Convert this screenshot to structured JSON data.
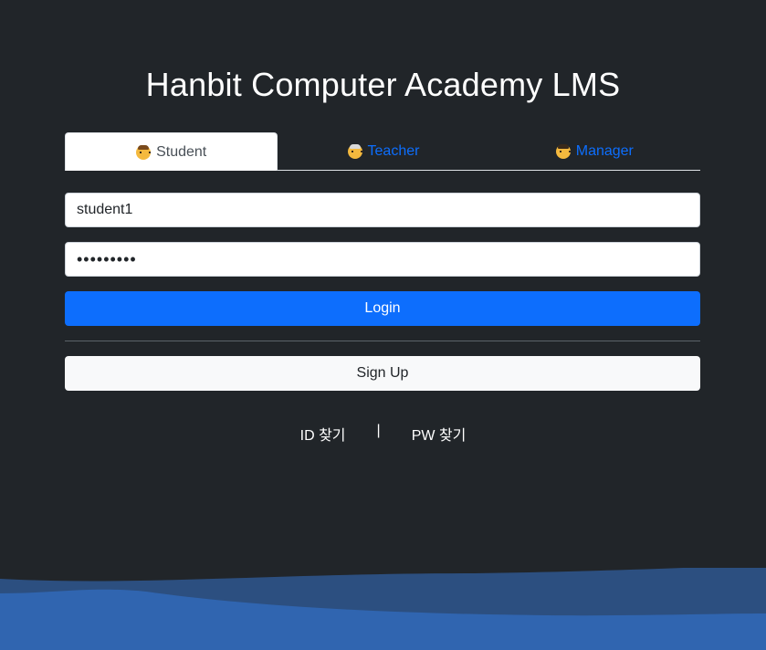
{
  "header": {
    "title": "Hanbit Computer Academy LMS"
  },
  "tabs": [
    {
      "label": "Student",
      "icon": "student-face-icon",
      "active": true
    },
    {
      "label": "Teacher",
      "icon": "teacher-face-icon",
      "active": false
    },
    {
      "label": "Manager",
      "icon": "manager-face-icon",
      "active": false
    }
  ],
  "form": {
    "id_value": "student1",
    "password_value": "•••••••••",
    "login_label": "Login",
    "signup_label": "Sign Up"
  },
  "links": {
    "find_id": "ID 찾기",
    "separator": "|",
    "find_pw": "PW 찾기"
  },
  "colors": {
    "background": "#212529",
    "primary": "#0d6efd",
    "wave_dark": "#2c4f80",
    "wave_light": "#3065b0"
  }
}
